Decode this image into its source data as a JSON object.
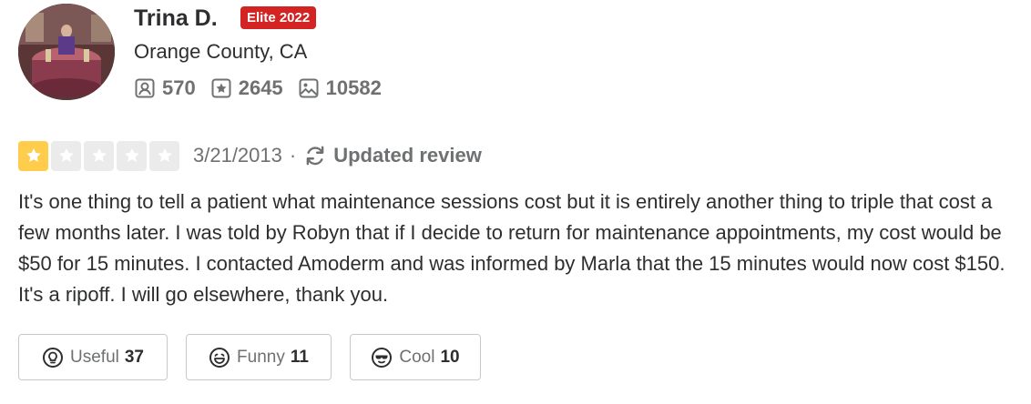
{
  "user": {
    "name": "Trina D.",
    "badge": "Elite 2022",
    "location": "Orange County, CA",
    "stats": {
      "friends": "570",
      "reviews": "2645",
      "photos": "10582"
    }
  },
  "review": {
    "rating": 1,
    "rating_max": 5,
    "date": "3/21/2013",
    "separator": "·",
    "updated_label": "Updated review",
    "text": "It's one thing to tell a patient what maintenance sessions cost but it is entirely another thing to triple that cost a few months later. I was told by Robyn that if I decide to return for maintenance appointments, my cost would be $50 for 15 minutes. I contacted Amoderm and was informed by Marla that the 15 minutes would now cost $150. It's a ripoff. I will go elsewhere, thank you."
  },
  "reactions": {
    "useful": {
      "label": "Useful",
      "count": "37"
    },
    "funny": {
      "label": "Funny",
      "count": "11"
    },
    "cool": {
      "label": "Cool",
      "count": "10"
    }
  },
  "colors": {
    "elite_red": "#d32323",
    "star_yellow": "#ffcc4b",
    "star_empty": "#ebebeb",
    "muted_text": "#6e7072"
  },
  "icons": {
    "friends": "friends-icon",
    "reviews": "star-box-icon",
    "photos": "photo-icon",
    "updated": "refresh-icon",
    "useful": "lightbulb-icon",
    "funny": "smile-icon",
    "cool": "sunglasses-icon"
  }
}
